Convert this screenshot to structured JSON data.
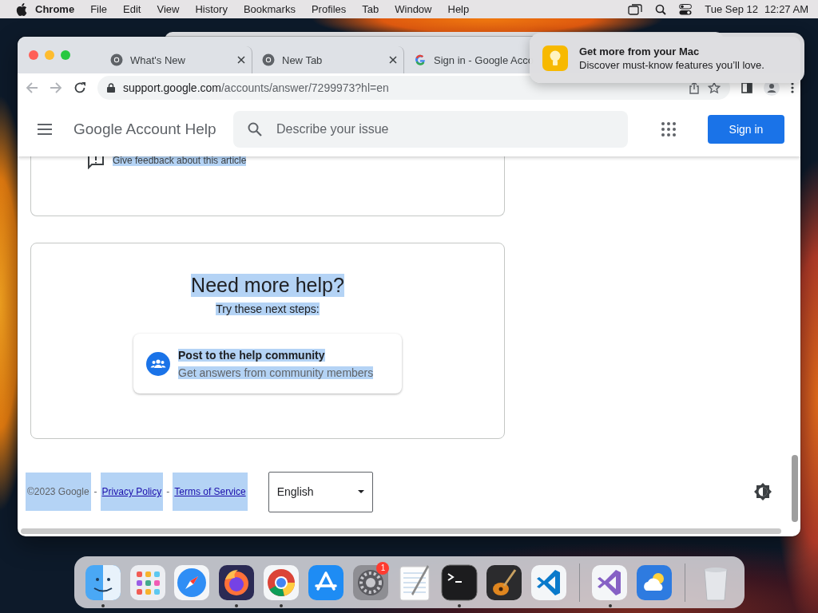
{
  "menu_bar": {
    "app_name": "Chrome",
    "items": [
      "File",
      "Edit",
      "View",
      "History",
      "Bookmarks",
      "Profiles",
      "Tab",
      "Window",
      "Help"
    ],
    "date": "Tue Sep 12",
    "time": "12:27 AM"
  },
  "browser": {
    "tabs": [
      {
        "title": "What's New",
        "kind": "chrome",
        "selected": false,
        "closable": true
      },
      {
        "title": "New Tab",
        "kind": "chrome",
        "selected": false,
        "closable": true
      },
      {
        "title": "Sign in - Google Acco",
        "kind": "google",
        "selected": false,
        "closable": false
      }
    ],
    "address": {
      "host": "support.google.com",
      "path": "/accounts/answer/7299973?hl=en"
    }
  },
  "page": {
    "header": {
      "title": "Google Account Help",
      "search_placeholder": "Describe your issue",
      "sign_in": "Sign in"
    },
    "feedback": {
      "label": "Give feedback about this article",
      "highlighted": true
    },
    "help_card": {
      "title": "Need more help?",
      "title_highlighted": true,
      "subtitle": "Try these next steps:",
      "subtitle_highlighted": true,
      "option": {
        "title": "Post to the help community",
        "description": "Get answers from community members",
        "highlighted": true
      }
    },
    "footer": {
      "copyright": "©2023 Google",
      "separator": "-",
      "links": [
        "Privacy Policy",
        "Terms of Service"
      ],
      "highlighted": true,
      "language": "English"
    }
  },
  "notification": {
    "title": "Get more from your Mac",
    "body": "Discover must-know features you’ll love."
  },
  "dock": {
    "sections": [
      [
        {
          "kind": "finder",
          "running": true
        },
        {
          "kind": "launchpad",
          "running": false
        },
        {
          "kind": "safari",
          "running": false
        },
        {
          "kind": "firefox",
          "running": true
        },
        {
          "kind": "chrome",
          "running": true
        },
        {
          "kind": "appstore",
          "running": false
        },
        {
          "kind": "settings",
          "running": false,
          "badge": "1"
        },
        {
          "kind": "textedit",
          "running": false
        },
        {
          "kind": "terminal",
          "running": true
        },
        {
          "kind": "garageband",
          "running": false
        },
        {
          "kind": "vscode",
          "running": false
        }
      ],
      [
        {
          "kind": "visualstudio",
          "running": true
        },
        {
          "kind": "weather",
          "running": false
        }
      ],
      [
        {
          "kind": "trash",
          "running": false
        }
      ]
    ]
  }
}
